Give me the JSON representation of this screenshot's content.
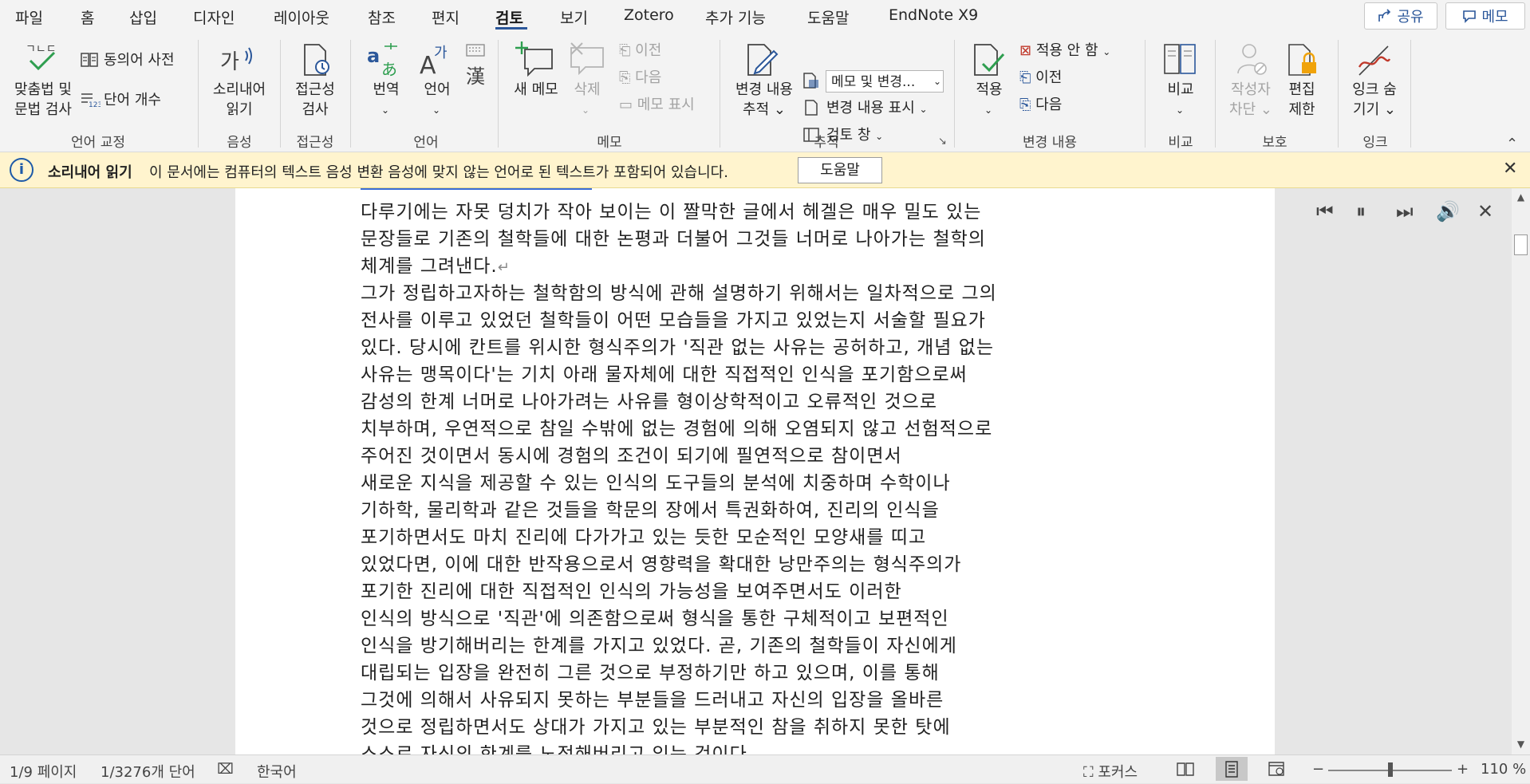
{
  "menu": {
    "tabs": [
      "파일",
      "홈",
      "삽입",
      "디자인",
      "레이아웃",
      "참조",
      "편지",
      "검토",
      "보기",
      "Zotero",
      "추가 기능",
      "도움말",
      "EndNote X9"
    ],
    "active_tab": "검토",
    "share_label": "공유",
    "comment_label": "메모"
  },
  "ribbon": {
    "proofing": {
      "group": "언어 교정",
      "spell_line1": "맞춤법 및",
      "spell_line2": "문법 검사",
      "thesaurus": "동의어 사전",
      "word_count": "단어 개수"
    },
    "speech": {
      "group": "음성",
      "read_line1": "소리내어",
      "read_line2": "읽기"
    },
    "accessibility": {
      "group": "접근성",
      "check_line1": "접근성",
      "check_line2": "검사"
    },
    "language": {
      "group": "언어",
      "translate": "번역",
      "language": "언어"
    },
    "comments": {
      "group": "메모",
      "new": "새 메모",
      "delete": "삭제",
      "prev": "이전",
      "next": "다음",
      "show": "메모 표시"
    },
    "tracking": {
      "group": "추적",
      "track_line1": "변경 내용",
      "track_line2": "추적",
      "markup_select": "메모 및 변경...",
      "show_markup": "변경 내용 표시",
      "review_pane": "검토 창"
    },
    "changes": {
      "group": "변경 내용",
      "accept": "적용",
      "reject": "적용 안 함",
      "prev": "이전",
      "next": "다음"
    },
    "compare": {
      "group": "비교",
      "compare": "비교"
    },
    "protect": {
      "group": "보호",
      "block_line1": "작성자",
      "block_line2": "차단",
      "restrict_line1": "편집",
      "restrict_line2": "제한"
    },
    "ink": {
      "group": "잉크",
      "hide_line1": "잉크 숨",
      "hide_line2": "기기"
    }
  },
  "notification": {
    "title": "소리내어 읽기",
    "message": "이 문서에는 컴퓨터의 텍스트 음성 변환 음성에 맞지 않는 언어로 된 텍스트가 포함되어 있습니다.",
    "help_button": "도움말"
  },
  "document": {
    "lines": [
      "다루기에는 자못 덩치가  작아 보이는 이 짤막한 글에서 헤겔은 매우 밀도 있는",
      "문장들로 기존의 철학들에 대한 논평과  더불어 그것들 너머로 나아가는 철학의",
      "체계를 그려낸다.",
      "그가 정립하고자하는 철학함의 방식에 관해 설명하기 위해서는 일차적으로 그의",
      "전사를  이루고 있었던 철학들이 어떤 모습들을 가지고 있었는지 서술할 필요가",
      "있다. 당시에 칸트를  위시한 형식주의가 '직관 없는 사유는 공허하고, 개념 없는",
      "사유는 맹목이다'는 기치 아래  물자체에 대한 직접적인 인식을 포기함으로써",
      "감성의 한계 너머로 나아가려는 사유를  형이상학적이고 오류적인 것으로",
      "치부하며, 우연적으로 참일 수밖에 없는 경험에 의해 오염되지  않고 선험적으로",
      "주어진 것이면서 동시에 경험의 조건이 되기에 필연적으로 참이면서",
      "새로운  지식을 제공할 수 있는 인식의 도구들의 분석에 치중하며 수학이나",
      "기하학, 물리학과 같은  것들을 학문의 장에서 특권화하여, 진리의 인식을",
      "포기하면서도 마치 진리에 다가가고 있는  듯한 모순적인 모양새를 띠고",
      "있었다면, 이에 대한 반작용으로서 영향력을 확대한 낭만주의는  형식주의가",
      "포기한 진리에 대한 직접적인 인식의 가능성을 보여주면서도 이러한",
      "인식의  방식으로 '직관'에 의존함으로써 형식을 통한 구체적이고 보편적인",
      "인식을 방기해버리는 한계를  가지고 있었다. 곧, 기존의 철학들이 자신에게",
      "대립되는 입장을 완전히 그른 것으로 부정하기만  하고 있으며, 이를 통해",
      "그것에 의해서 사유되지 못하는 부분들을 드러내고 자신의 입장을  올바른",
      "것으로 정립하면서도 상대가 가지고 있는 부분적인 참을 취하지 못한 탓에",
      "스스로  자신의 한계를 노정해버리고 있는 것이다."
    ]
  },
  "status": {
    "page": "1/9 페이지",
    "words": "1/3276개 단어",
    "language": "한국어",
    "focus": "포커스",
    "zoom_minus": "−",
    "zoom_plus": "+",
    "zoom": "110 %",
    "zoom_level_percent": 110
  }
}
